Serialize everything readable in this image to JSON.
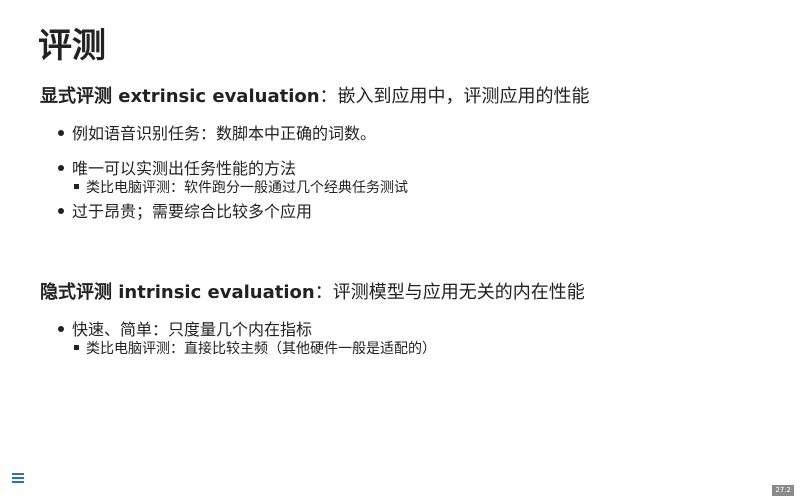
{
  "slide": {
    "title": "评测",
    "extrinsic": {
      "term": "显式评测 extrinsic evaluation",
      "desc": "：嵌入到应用中，评测应用的性能",
      "bullets": [
        "例如语音识别任务：数脚本中正确的词数。",
        "唯一可以实测出任务性能的方法",
        "过于昂贵；需要综合比较多个应用"
      ],
      "sub_bullets": [
        "类比电脑评测：软件跑分一般通过几个经典任务测试"
      ]
    },
    "intrinsic": {
      "term": "隐式评测 intrinsic evaluation",
      "desc": "：评测模型与应用无关的内在性能",
      "bullets": [
        "快速、简单：只度量几个内在指标"
      ],
      "sub_bullets": [
        "类比电脑评测：直接比较主频（其他硬件一般是适配的）"
      ]
    }
  },
  "footer": {
    "menu_icon": "hamburger-menu-icon",
    "page_number": "27.2"
  },
  "colors": {
    "text": "#222222",
    "menu_icon": "#2a6fd6",
    "page_badge": "#8a8a8a"
  }
}
